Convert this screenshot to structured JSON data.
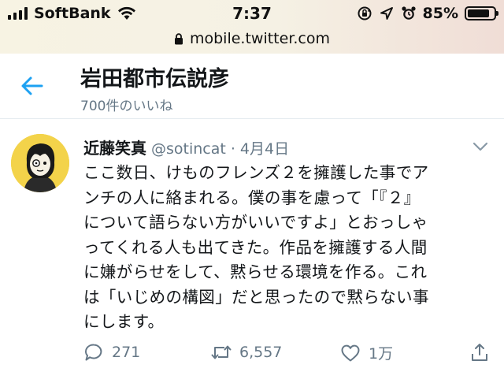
{
  "status_bar": {
    "carrier": "SoftBank",
    "time": "7:37",
    "battery_percent_text": "85%",
    "battery_level": 0.85,
    "icons": [
      "signal-bars-icon",
      "wifi-icon",
      "orientation-lock-icon",
      "location-arrow-icon",
      "alarm-icon",
      "battery-icon"
    ]
  },
  "address_bar": {
    "url": "mobile.twitter.com",
    "icon": "lock-icon"
  },
  "header": {
    "title": "岩田都市伝説彦",
    "subtitle": "700件のいいね",
    "back_icon": "back-arrow-icon"
  },
  "tweet": {
    "author_name": "近藤笑真",
    "handle": "@sotincat",
    "separator": "·",
    "date": "4月4日",
    "text_lines": [
      "ここ数日、けものフレンズ２を擁護した事でア",
      "ンチの人に絡まれる。僕の事を慮って「『２』",
      "について語らない方がいいですよ」とおっしゃ",
      "ってくれる人も出てきた。作品を擁護する人間",
      "に嫌がらせをして、黙らせる環境を作る。これ",
      "は「いじめの構図」だと思ったので黙らない事",
      "にします。"
    ],
    "actions": {
      "reply_count": "271",
      "retweet_count": "6,557",
      "like_count": "1万"
    }
  },
  "colors": {
    "accent": "#1da1f2",
    "text": "#14171a",
    "secondary": "#657786",
    "avatar_bg": "#f3d34a"
  }
}
